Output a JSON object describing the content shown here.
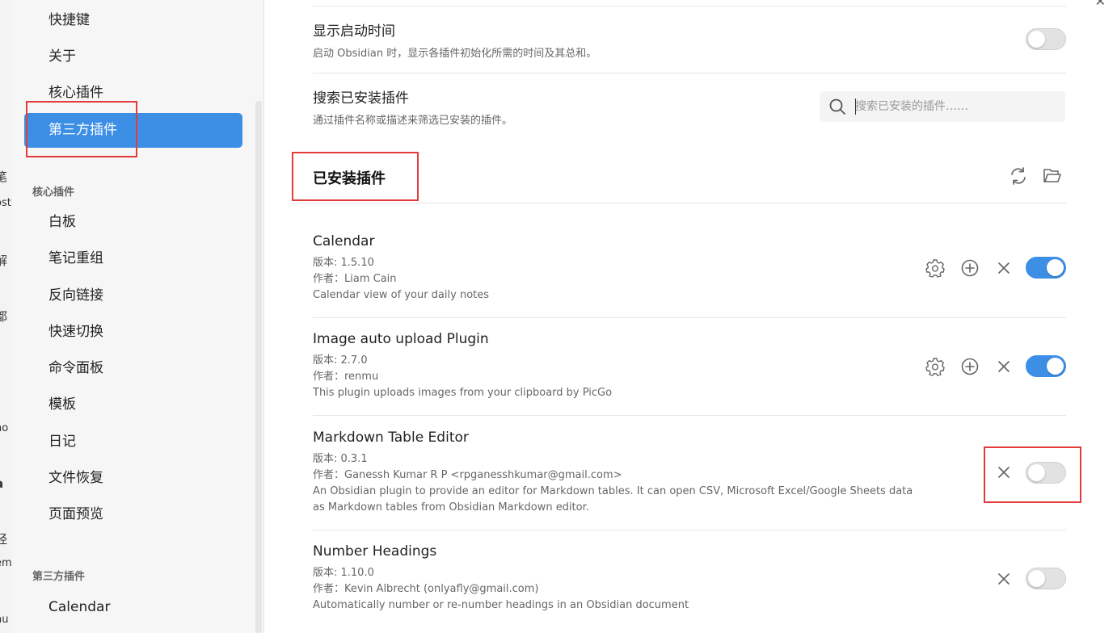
{
  "background_fragments": [
    "笔",
    "ost",
    "解",
    "都",
    "no",
    "a",
    "l",
    "经",
    "em",
    "hu"
  ],
  "sidebar": {
    "items_top": [
      {
        "label": "快捷键"
      },
      {
        "label": "关于"
      },
      {
        "label": "核心插件"
      },
      {
        "label": "第三方插件",
        "active": true
      }
    ],
    "core_heading": "核心插件",
    "core_items": [
      {
        "label": "白板"
      },
      {
        "label": "笔记重组"
      },
      {
        "label": "反向链接"
      },
      {
        "label": "快速切换"
      },
      {
        "label": "命令面板"
      },
      {
        "label": "模板"
      },
      {
        "label": "日记"
      },
      {
        "label": "文件恢复"
      },
      {
        "label": "页面预览"
      }
    ],
    "thirdparty_heading": "第三方插件",
    "thirdparty_items": [
      {
        "label": "Calendar"
      }
    ]
  },
  "settings": {
    "startup_time": {
      "name": "显示启动时间",
      "desc": "启动 Obsidian 时，显示各插件初始化所需的时间及其总和。",
      "enabled": false
    },
    "search": {
      "name": "搜索已安装插件",
      "desc": "通过插件名称或描述来筛选已安装的插件。",
      "placeholder": "搜索已安装的插件……"
    }
  },
  "installed": {
    "title": "已安装插件",
    "plugins": [
      {
        "name": "Calendar",
        "version": "版本: 1.5.10",
        "author": "作者：Liam Cain",
        "desc": "Calendar view of your daily notes",
        "desc2": "",
        "has_settings": true,
        "enabled": true
      },
      {
        "name": "Image auto upload Plugin",
        "version": "版本: 2.7.0",
        "author": "作者：renmu",
        "desc": "This plugin uploads images from your clipboard by PicGo",
        "desc2": "",
        "has_settings": true,
        "enabled": true
      },
      {
        "name": "Markdown Table Editor",
        "version": "版本: 0.3.1",
        "author": "作者：Ganessh Kumar R P <rpganesshkumar@gmail.com>",
        "desc": "An Obsidian plugin to provide an editor for Markdown tables. It can open CSV, Microsoft Excel/Google Sheets data",
        "desc2": "as Markdown tables from Obsidian Markdown editor.",
        "has_settings": false,
        "enabled": false
      },
      {
        "name": "Number Headings",
        "version": "版本: 1.10.0",
        "author": "作者：Kevin Albrecht (onlyafly@gmail.com)",
        "desc": "Automatically number or re-number headings in an Obsidian document",
        "desc2": "",
        "has_settings": false,
        "enabled": false
      }
    ]
  },
  "icons": {
    "search": "search-icon",
    "reload": "reload-icon",
    "folder": "folder-open-icon",
    "gear": "gear-icon",
    "plus": "plus-circle-icon",
    "uninstall": "close-icon"
  },
  "colors": {
    "accent": "#3d8fe6",
    "highlight_box": "#e23b3b"
  }
}
